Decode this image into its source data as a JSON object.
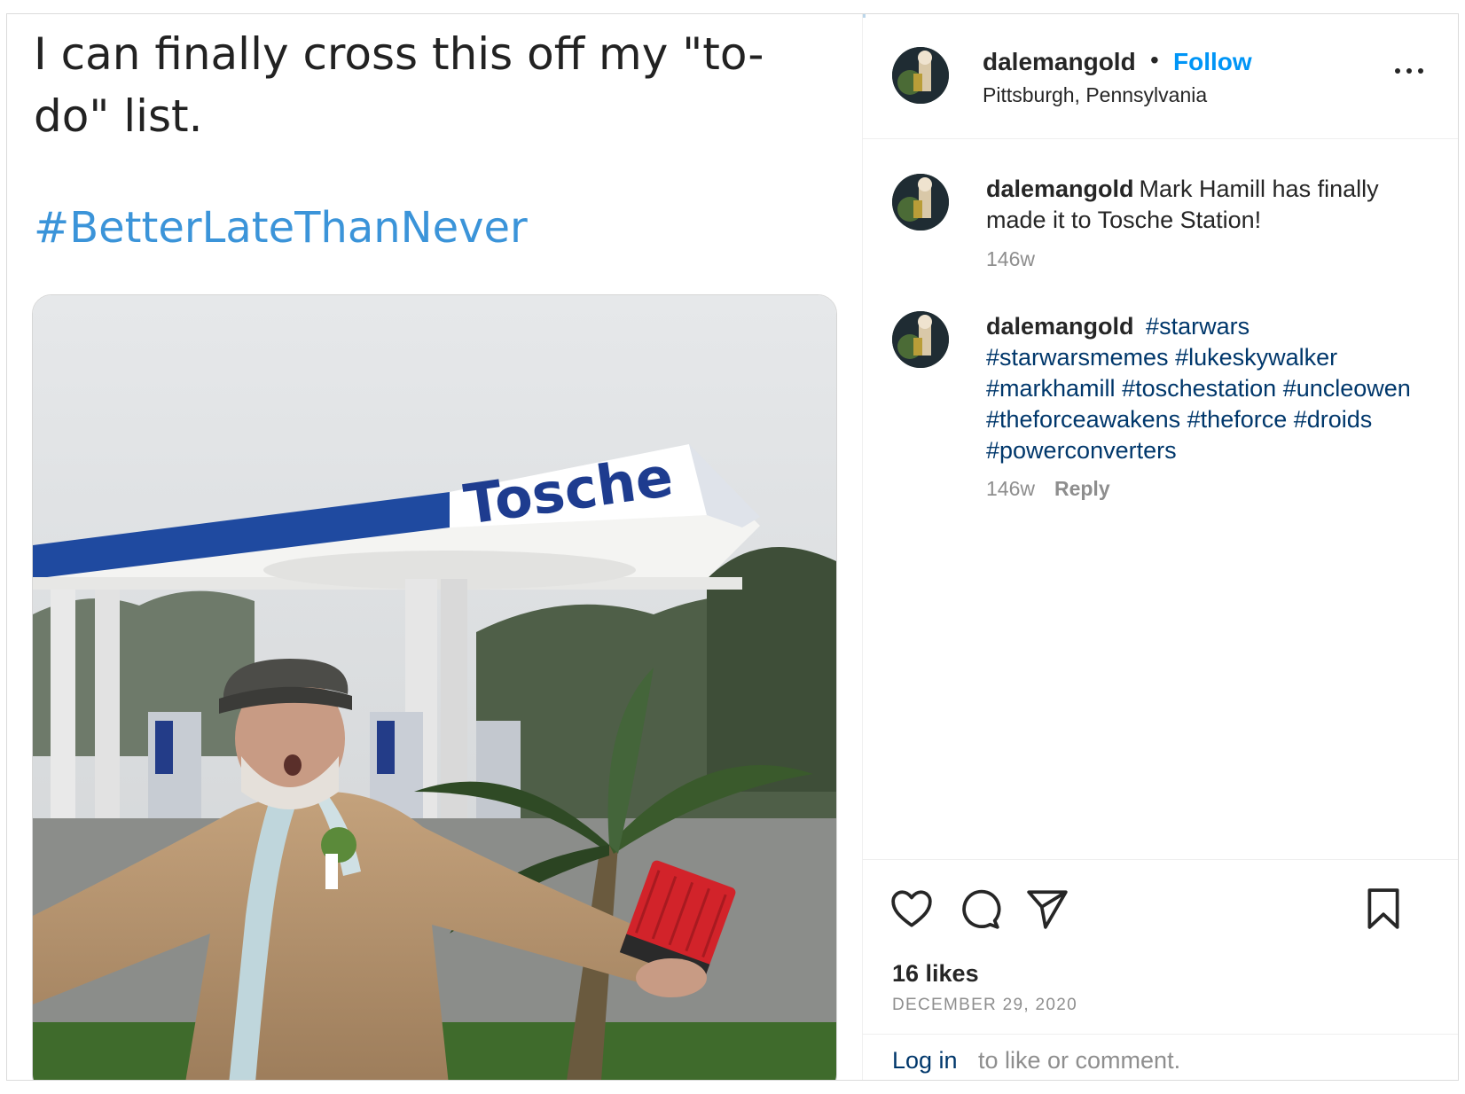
{
  "media": {
    "tweet_text": "I can finally cross this off my \"to-do\" list.",
    "tweet_hashtag": "#BetterLateThanNever",
    "sign_text": "Tosche"
  },
  "header": {
    "username": "dalemangold",
    "separator": "•",
    "follow_label": "Follow",
    "location": "Pittsburgh, Pennsylvania",
    "more_icon": "more-horizontal-icon"
  },
  "comments": [
    {
      "username": "dalemangold",
      "text": "Mark Hamill has finally made it to Tosche Station!",
      "age": "146w"
    },
    {
      "username": "dalemangold",
      "tags": [
        "#starwars",
        "#starwarsmemes",
        "#lukeskywalker",
        "#markhamill",
        "#toschestation",
        "#uncleowen",
        "#theforceawakens",
        "#theforce",
        "#droids",
        "#powerconverters"
      ],
      "age": "146w",
      "reply_label": "Reply"
    }
  ],
  "actions": {
    "like_icon": "heart-icon",
    "comment_icon": "comment-icon",
    "share_icon": "send-icon",
    "save_icon": "bookmark-icon",
    "likes": "16 likes",
    "date": "DECEMBER 29, 2020",
    "login_link": "Log in",
    "login_rest": "to like or comment."
  },
  "colors": {
    "link_blue": "#0095f6",
    "hashtag_dark": "#00376b",
    "tweet_hashtag_blue": "#3b94d9",
    "muted": "#8e8e8e",
    "text": "#262626"
  }
}
